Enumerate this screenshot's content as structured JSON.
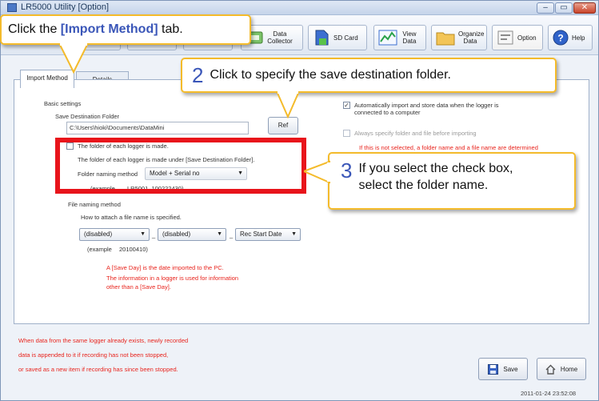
{
  "window": {
    "title": "LR5000 Utility [Option]",
    "min": "–",
    "max": "▭",
    "close": "✕"
  },
  "toolbar": {
    "data_collector": "Data Collector",
    "sd_card": "SD Card",
    "view_data": "View Data",
    "organize_data": "Organize Data",
    "option": "Option",
    "help": "Help"
  },
  "tabs": {
    "import_method": "Import Method",
    "details": "Details"
  },
  "basic": {
    "heading": "Basic settings",
    "save_dest_label": "Save Destination Folder",
    "save_dest_value": "C:\\Users\\hioki\\Documents\\DataMini",
    "ref_button": "Ref",
    "folder_each_logger": "The folder of each logger is made.",
    "folder_under_note": "The folder of each logger is made under [Save Destination Folder].",
    "folder_naming_label": "Folder naming method",
    "folder_naming_value": "Model + Serial no",
    "example_label": "(example",
    "example_value": "LR5001_100222430)",
    "file_naming_label": "File naming method",
    "file_naming_note": "How to attach a file name is specified.",
    "sel1": "(disabled)",
    "sel2": "(disabled)",
    "sel3": "Rec Start Date",
    "sep": "_",
    "file_example_label": "(example",
    "file_example_value": "20100410)",
    "note1": "A [Save Day] is the date imported to the PC.",
    "note2": "The information in a logger is used for information",
    "note3": "other than a [Save Day]."
  },
  "right": {
    "auto_import": "Automatically import and store data when the logger is",
    "auto_import2": "connected to a computer",
    "always_specify": "Always specify folder and file before importing",
    "warn": "If this is not selected, a folder name and a file name are determined"
  },
  "footer": {
    "line1": "When data from the same logger already exists, newly recorded",
    "line2": "data is appended to it if recording has not been stopped,",
    "line3": "or saved as a new item if recording has since been stopped.",
    "save": "Save",
    "home": "Home",
    "timestamp": "2011-01-24 23:52:08"
  },
  "callouts": {
    "c1_prefix": "Click the ",
    "c1_bold": "[Import Method]",
    "c1_suffix": " tab.",
    "c2_num": "2",
    "c2_text": "Click to specify the save destination folder.",
    "c3_num": "3",
    "c3_line1": "If you select the check box,",
    "c3_line2": "select the folder name."
  },
  "colors": {
    "accent": "#f4bb2b",
    "highlight": "#e8141b",
    "callout_number": "#3a56b8"
  }
}
